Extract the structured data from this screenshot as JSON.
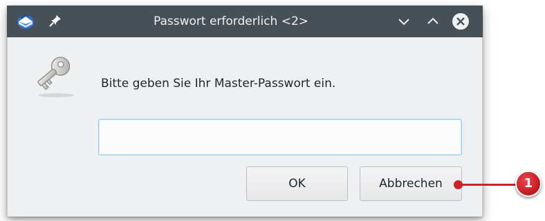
{
  "window": {
    "title": "Passwort erforderlich <2>"
  },
  "dialog": {
    "prompt": "Bitte geben Sie Ihr Master-Passwort ein.",
    "password_value": "",
    "ok_label": "OK",
    "cancel_label": "Abbrechen"
  },
  "annotation": {
    "badge_number": "1",
    "color": "#d0202a"
  },
  "icons": {
    "app": "thunderbird-icon",
    "pin": "pin-icon",
    "minimize": "chevron-down-icon",
    "maximize": "chevron-up-icon",
    "close": "close-icon",
    "key": "key-icon"
  },
  "colors": {
    "titlebar": "#475057",
    "window_bg": "#eff0f1",
    "input_focus": "#93cee9"
  }
}
